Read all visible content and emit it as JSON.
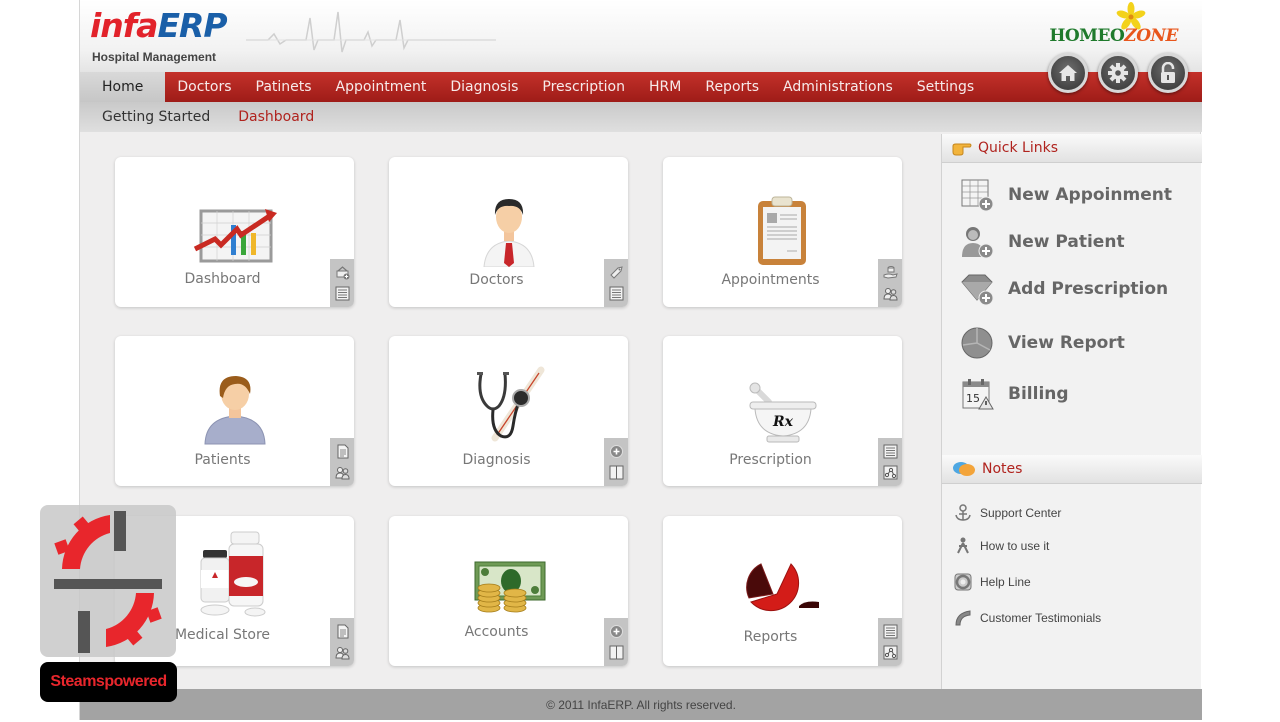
{
  "header": {
    "logo_part1": "infa",
    "logo_part2": "ERP",
    "logo_subtitle": "Hospital Management",
    "partner_brand_1": "HOMEO",
    "partner_brand_2": "ZONE",
    "round_buttons": [
      {
        "icon": "home-icon"
      },
      {
        "icon": "gear-icon"
      },
      {
        "icon": "unlock-icon"
      }
    ]
  },
  "nav": {
    "items": [
      "Home",
      "Doctors",
      "Patinets",
      "Appointment",
      "Diagnosis",
      "Prescription",
      "HRM",
      "Reports",
      "Administrations",
      "Settings"
    ],
    "active": "Home"
  },
  "subnav": {
    "items": [
      "Getting Started",
      "Dashboard"
    ],
    "active": "Dashboard"
  },
  "tiles": [
    {
      "label": "Dashboard",
      "icon": "chart-icon",
      "actions": [
        "basket-add-icon",
        "list-icon"
      ]
    },
    {
      "label": "Doctors",
      "icon": "doctor-icon",
      "actions": [
        "tag-icon",
        "list-icon"
      ]
    },
    {
      "label": "Appointments",
      "icon": "clipboard-icon",
      "actions": [
        "hand-coins-icon",
        "users-icon"
      ]
    },
    {
      "label": "Patients",
      "icon": "patient-icon",
      "actions": [
        "document-icon",
        "users-icon"
      ]
    },
    {
      "label": "Diagnosis",
      "icon": "stethoscope-icon",
      "actions": [
        "plus-circle-icon",
        "columns-icon"
      ]
    },
    {
      "label": "Prescription",
      "icon": "mortar-rx-icon",
      "actions": [
        "list-icon",
        "share-nodes-icon"
      ]
    },
    {
      "label": "Medical Store",
      "icon": "pill-bottles-icon",
      "actions": [
        "document-icon",
        "users-icon"
      ]
    },
    {
      "label": "Accounts",
      "icon": "money-icon",
      "actions": [
        "plus-circle-icon",
        "columns-icon"
      ]
    },
    {
      "label": "Reports",
      "icon": "pie-chart-icon",
      "actions": [
        "list-icon",
        "share-nodes-icon"
      ]
    }
  ],
  "quick_links": {
    "title": "Quick Links",
    "items": [
      {
        "label": "New Appoinment",
        "icon": "calendar-add-icon"
      },
      {
        "label": "New Patient",
        "icon": "user-add-icon"
      },
      {
        "label": "Add Prescription",
        "icon": "gem-add-icon"
      },
      {
        "label": "View Report",
        "icon": "pie-icon"
      },
      {
        "label": "Billing",
        "icon": "calendar-warning-icon",
        "icon_text": "15"
      }
    ]
  },
  "notes": {
    "title": "Notes",
    "items": [
      {
        "label": "Support Center",
        "icon": "anchor-icon"
      },
      {
        "label": "How to use it",
        "icon": "person-icon"
      },
      {
        "label": "Help Line",
        "icon": "lifebuoy-icon"
      },
      {
        "label": "Customer Testimonials",
        "icon": "quote-icon"
      }
    ]
  },
  "footer": {
    "text": "© 2011 InfaERP. All rights reserved."
  },
  "watermark": {
    "label": "Steamspowered"
  },
  "colors": {
    "brand_red": "#b0231e",
    "nav_red": "#c4312a",
    "logo_blue": "#1a5fa8",
    "logo_red": "#e2232b"
  }
}
